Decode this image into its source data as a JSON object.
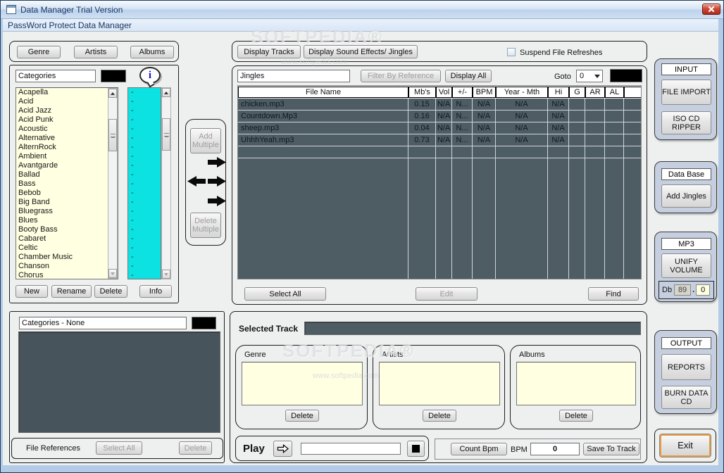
{
  "window": {
    "title": "Data Manager Trial Version",
    "menu": "PassWord Protect Data Manager"
  },
  "watermark": {
    "brand": "SOFTPEDIA®",
    "url": "www.softpedia.com"
  },
  "left_panel": {
    "tab_buttons": [
      "Genre",
      "Artists",
      "Albums"
    ],
    "categories_value": "Categories",
    "genres": [
      "Acapella",
      "Acid",
      "Acid Jazz",
      "Acid Punk",
      "Acoustic",
      "Alternative",
      "AlternRock",
      "Ambient",
      "Avantgarde",
      "Ballad",
      "Bass",
      "Bebob",
      "Big Band",
      "Bluegrass",
      "Blues",
      "Booty Bass",
      "Cabaret",
      "Celtic",
      "Chamber Music",
      "Chanson",
      "Chorus"
    ],
    "dash_items": [
      "-",
      "-",
      "-",
      "-",
      "-",
      "-",
      "-",
      "-",
      "-",
      "-",
      "-",
      "-",
      "-",
      "-",
      "-",
      "-",
      "-",
      "-",
      "-",
      "-",
      "-"
    ],
    "new_label": "New",
    "rename_label": "Rename",
    "delete_label": "Delete",
    "info_label": "Info"
  },
  "connector": {
    "add_multiple": "Add Multiple",
    "delete_multiple": "Delete Multiple"
  },
  "tracks_panel": {
    "display_tracks": "Display Tracks",
    "display_jingles": "Display Sound Effects/ Jingles",
    "suspend_checkbox": "Suspend File Refreshes",
    "search_value": "Jingles",
    "filter_button": "Filter By Reference",
    "display_all_button": "Display  All",
    "goto_label": "Goto",
    "goto_value": "0",
    "columns": [
      "File Name",
      "Mb's",
      "Vol",
      "+/-",
      "BPM",
      "Year - Mth",
      "Hi",
      "G",
      "AR",
      "AL",
      ""
    ],
    "rows": [
      [
        "chicken.mp3",
        "0.15",
        "N/A",
        "N...",
        "N/A",
        "N/A",
        "N/A",
        "",
        "",
        "",
        ""
      ],
      [
        "Countdown.Mp3",
        "0.16",
        "N/A",
        "N...",
        "N/A",
        "N/A",
        "N/A",
        "",
        "",
        "",
        ""
      ],
      [
        "sheep.mp3",
        "0.04",
        "N/A",
        "N...",
        "N/A",
        "N/A",
        "N/A",
        "",
        "",
        "",
        ""
      ],
      [
        "UhhhYeah.mp3",
        "0.73",
        "N/A",
        "N...",
        "N/A",
        "N/A",
        "N/A",
        "",
        "",
        "",
        ""
      ]
    ],
    "select_all": "Select All",
    "edit": "Edit",
    "find": "Find"
  },
  "sidebar": {
    "input_label": "INPUT",
    "file_import": "FILE IMPORT",
    "iso_cd_ripper": "ISO CD RIPPER",
    "database_label": "Data Base",
    "add_jingles": "Add Jingles",
    "mp3_label": "MP3",
    "unify_volume": "UNIFY VOLUME",
    "db_label": "Db",
    "db_int": "89",
    "db_dot": ".",
    "db_dec": "0",
    "output_label": "OUTPUT",
    "reports": "REPORTS",
    "burn_data_cd": "BURN DATA CD",
    "exit": "Exit"
  },
  "references_panel": {
    "header_value": "Categories - None",
    "file_references": "File References",
    "select_all": "Select All",
    "delete": "Delete"
  },
  "selected_panel": {
    "selected_track_label": "Selected Track",
    "groups": [
      {
        "label": "Genre",
        "delete": "Delete"
      },
      {
        "label": "Artists",
        "delete": "Delete"
      },
      {
        "label": "Albums",
        "delete": "Delete"
      }
    ],
    "play_label": "Play",
    "count_bpm": "Count Bpm",
    "bpm_label": "BPM",
    "bpm_value": "0",
    "save_to_track": "Save To Track"
  },
  "colors": {
    "accent_cyan": "#0ce2e2",
    "cream": "#ffffe1",
    "slate": "#4e5c64",
    "sidebar_bg": "#c6cfdf",
    "exit_focus": "#e89b3f",
    "close_red": "#c0392b",
    "title_text": "#17386b"
  }
}
